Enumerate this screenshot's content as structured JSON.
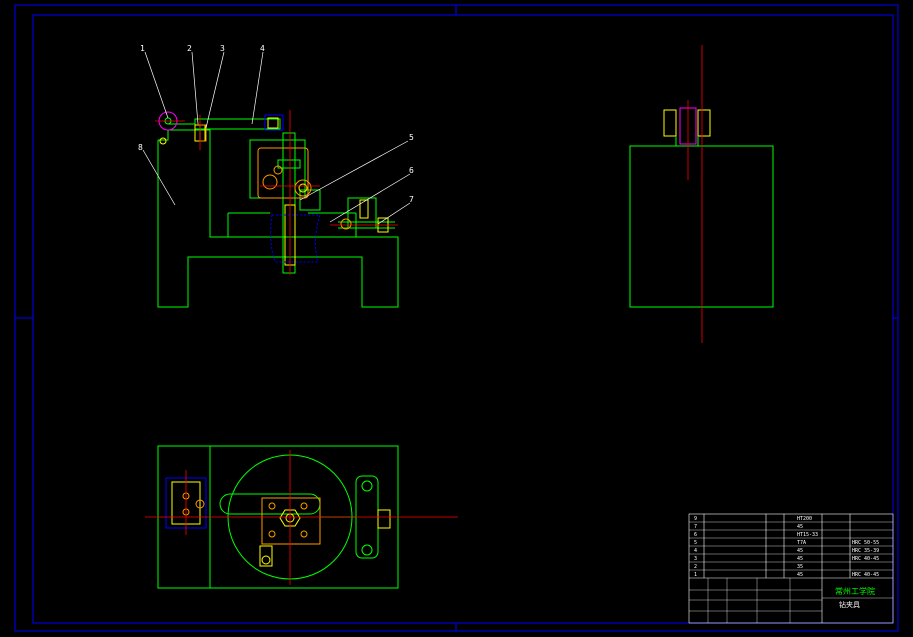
{
  "colors": {
    "background": "#000000",
    "frame": "#0000ff",
    "outline": "#00ff00",
    "center_line": "#ff0000",
    "hidden": "#0000ff",
    "part_orange": "#ff9900",
    "part_yellow": "#ffff00",
    "part_magenta": "#ff00ff",
    "text": "#ffffff"
  },
  "callouts": [
    "1",
    "2",
    "3",
    "4",
    "5",
    "6",
    "7",
    "8"
  ],
  "bom": {
    "rows": [
      {
        "no": "9",
        "material": "HT200",
        "note": ""
      },
      {
        "no": "7",
        "material": "45",
        "note": ""
      },
      {
        "no": "6",
        "material": "HT15-33",
        "note": ""
      },
      {
        "no": "5",
        "material": "T7A",
        "note": "HRC 50-55"
      },
      {
        "no": "4",
        "material": "45",
        "note": "HRC 35-39"
      },
      {
        "no": "3",
        "material": "45",
        "note": "HRC 40-45"
      },
      {
        "no": "2",
        "material": "35",
        "note": ""
      },
      {
        "no": "1",
        "material": "45",
        "note": "HRC 40-45"
      }
    ]
  },
  "title_block": {
    "school": "常州工学院",
    "drawing_name": "钻夹具"
  }
}
